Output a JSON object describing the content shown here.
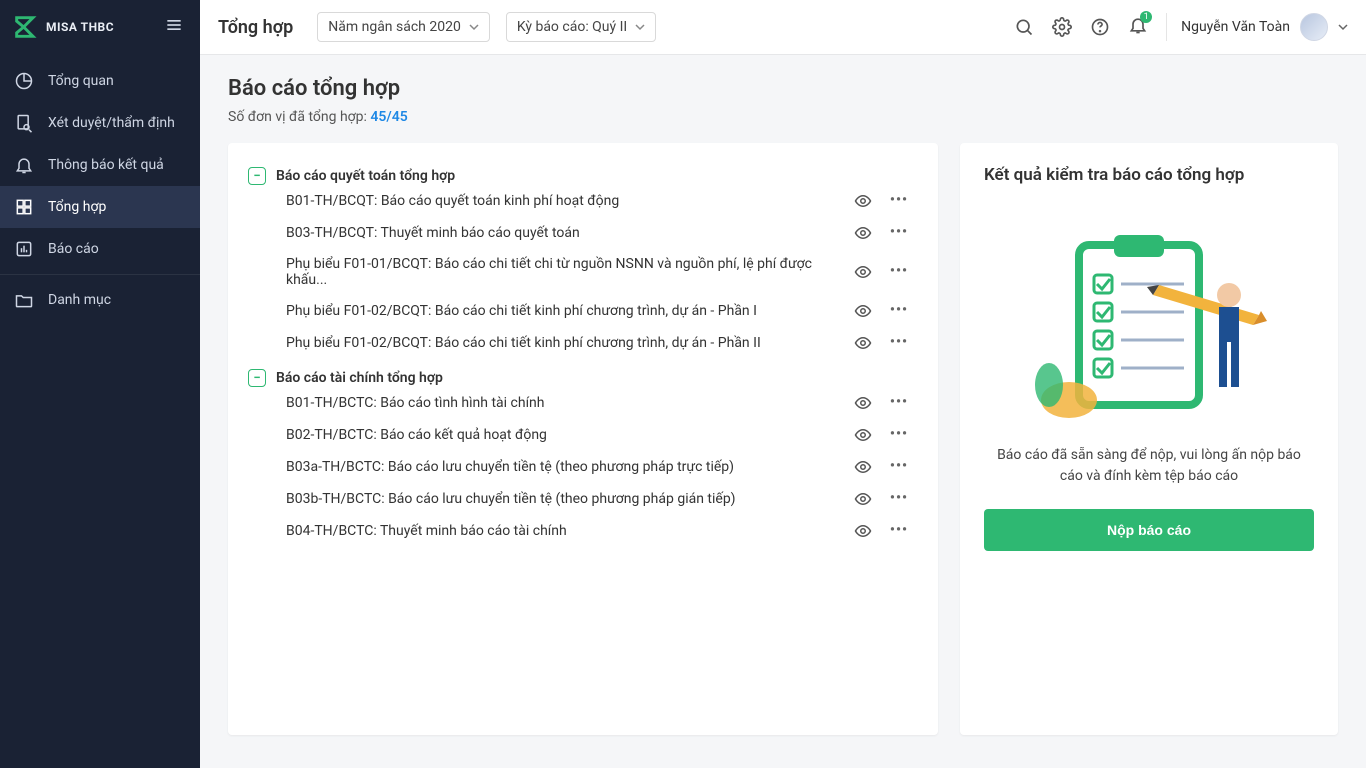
{
  "brand": {
    "text": "MISA THBC"
  },
  "sidebar": {
    "items": [
      {
        "label": "Tổng quan"
      },
      {
        "label": "Xét duyệt/thẩm định"
      },
      {
        "label": "Thông báo kết quả"
      },
      {
        "label": "Tổng hợp"
      },
      {
        "label": "Báo cáo"
      },
      {
        "label": "Danh mục"
      }
    ]
  },
  "topbar": {
    "title": "Tổng hợp",
    "budget_year": "Năm ngân sách 2020",
    "period": "Kỳ báo cáo: Quý II",
    "user_name": "Nguyễn Văn Toàn",
    "bell_badge": "1"
  },
  "page": {
    "heading": "Báo cáo tổng hợp",
    "summary_label": "Số đơn vị đã tổng hợp:",
    "summary_count": "45/45"
  },
  "groups": [
    {
      "title": "Báo cáo quyết toán tổng hợp",
      "items": [
        "B01-TH/BCQT: Báo cáo quyết toán kinh phí hoạt động",
        "B03-TH/BCQT: Thuyết minh báo cáo quyết toán",
        "Phụ biểu F01-01/BCQT: Báo cáo chi tiết chi từ nguồn NSNN và nguồn phí, lệ phí được khấu...",
        "Phụ biểu F01-02/BCQT: Báo cáo chi tiết kinh phí chương trình, dự án - Phần I",
        "Phụ biểu F01-02/BCQT: Báo cáo chi tiết kinh phí chương trình, dự án - Phần II"
      ]
    },
    {
      "title": "Báo cáo tài chính tổng hợp",
      "items": [
        "B01-TH/BCTC: Báo cáo tình hình tài chính",
        "B02-TH/BCTC: Báo cáo kết quả hoạt động",
        "B03a-TH/BCTC: Báo cáo lưu chuyển tiền tệ (theo phương pháp trực tiếp)",
        "B03b-TH/BCTC: Báo cáo lưu chuyển tiền tệ (theo phương pháp gián tiếp)",
        "B04-TH/BCTC: Thuyết minh báo cáo tài chính"
      ]
    }
  ],
  "side_panel": {
    "title": "Kết quả kiểm tra báo cáo tổng hợp",
    "message": "Báo cáo đã sẵn sàng để nộp, vui lòng ấn nộp báo cáo và đính kèm tệp báo cáo",
    "submit_label": "Nộp báo cáo"
  },
  "colors": {
    "accent": "#2eb872",
    "link": "#1e88e5"
  }
}
